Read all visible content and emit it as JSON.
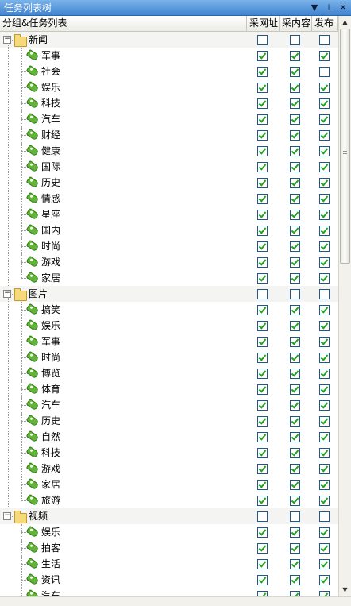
{
  "panel": {
    "title": "任务列表树",
    "buttons": [
      {
        "icon": "dropdown-icon",
        "glyph": "▼"
      },
      {
        "icon": "pin-icon",
        "glyph": "⊥"
      },
      {
        "icon": "close-icon",
        "glyph": "✕"
      }
    ]
  },
  "columns": {
    "name": "分组&任务列表",
    "col1": "采网址",
    "col2": "采内容",
    "col3": "发布"
  },
  "groups": [
    {
      "label": "新闻",
      "expanded": true,
      "checks": [
        false,
        false,
        false
      ],
      "items": [
        {
          "label": "军事",
          "checks": [
            true,
            true,
            true
          ]
        },
        {
          "label": "社会",
          "checks": [
            true,
            true,
            false
          ]
        },
        {
          "label": "娱乐",
          "checks": [
            true,
            true,
            true
          ]
        },
        {
          "label": "科技",
          "checks": [
            true,
            true,
            true
          ]
        },
        {
          "label": "汽车",
          "checks": [
            true,
            true,
            true
          ]
        },
        {
          "label": "财经",
          "checks": [
            true,
            true,
            true
          ]
        },
        {
          "label": "健康",
          "checks": [
            true,
            true,
            true
          ]
        },
        {
          "label": "国际",
          "checks": [
            true,
            true,
            true
          ]
        },
        {
          "label": "历史",
          "checks": [
            true,
            true,
            true
          ]
        },
        {
          "label": "情感",
          "checks": [
            true,
            true,
            true
          ]
        },
        {
          "label": "星座",
          "checks": [
            true,
            true,
            true
          ]
        },
        {
          "label": "国内",
          "checks": [
            true,
            true,
            true
          ]
        },
        {
          "label": "时尚",
          "checks": [
            true,
            true,
            true
          ]
        },
        {
          "label": "游戏",
          "checks": [
            true,
            true,
            true
          ]
        },
        {
          "label": "家居",
          "checks": [
            true,
            true,
            true
          ]
        }
      ]
    },
    {
      "label": "图片",
      "expanded": true,
      "checks": [
        false,
        false,
        false
      ],
      "items": [
        {
          "label": "搞笑",
          "checks": [
            true,
            true,
            true
          ]
        },
        {
          "label": "娱乐",
          "checks": [
            true,
            true,
            true
          ]
        },
        {
          "label": "军事",
          "checks": [
            true,
            true,
            true
          ]
        },
        {
          "label": "时尚",
          "checks": [
            true,
            true,
            true
          ]
        },
        {
          "label": "博览",
          "checks": [
            true,
            true,
            true
          ]
        },
        {
          "label": "体育",
          "checks": [
            true,
            true,
            true
          ]
        },
        {
          "label": "汽车",
          "checks": [
            true,
            true,
            true
          ]
        },
        {
          "label": "历史",
          "checks": [
            true,
            true,
            true
          ]
        },
        {
          "label": "自然",
          "checks": [
            true,
            true,
            true
          ]
        },
        {
          "label": "科技",
          "checks": [
            true,
            true,
            true
          ]
        },
        {
          "label": "游戏",
          "checks": [
            true,
            true,
            true
          ]
        },
        {
          "label": "家居",
          "checks": [
            true,
            true,
            true
          ]
        },
        {
          "label": "旅游",
          "checks": [
            true,
            true,
            true
          ]
        }
      ]
    },
    {
      "label": "视频",
      "expanded": true,
      "checks": [
        false,
        false,
        false
      ],
      "items": [
        {
          "label": "娱乐",
          "checks": [
            true,
            true,
            true
          ]
        },
        {
          "label": "拍客",
          "checks": [
            true,
            true,
            true
          ]
        },
        {
          "label": "生活",
          "checks": [
            true,
            true,
            true
          ]
        },
        {
          "label": "资讯",
          "checks": [
            true,
            true,
            true
          ]
        },
        {
          "label": "汽车",
          "checks": [
            true,
            true,
            true
          ]
        }
      ]
    }
  ],
  "scrollbar": {
    "up": "▲",
    "down": "▼"
  },
  "colors": {
    "title_bar": "#3f83d0",
    "check": "#21a121",
    "checkbox_border": "#1d5a8a"
  }
}
